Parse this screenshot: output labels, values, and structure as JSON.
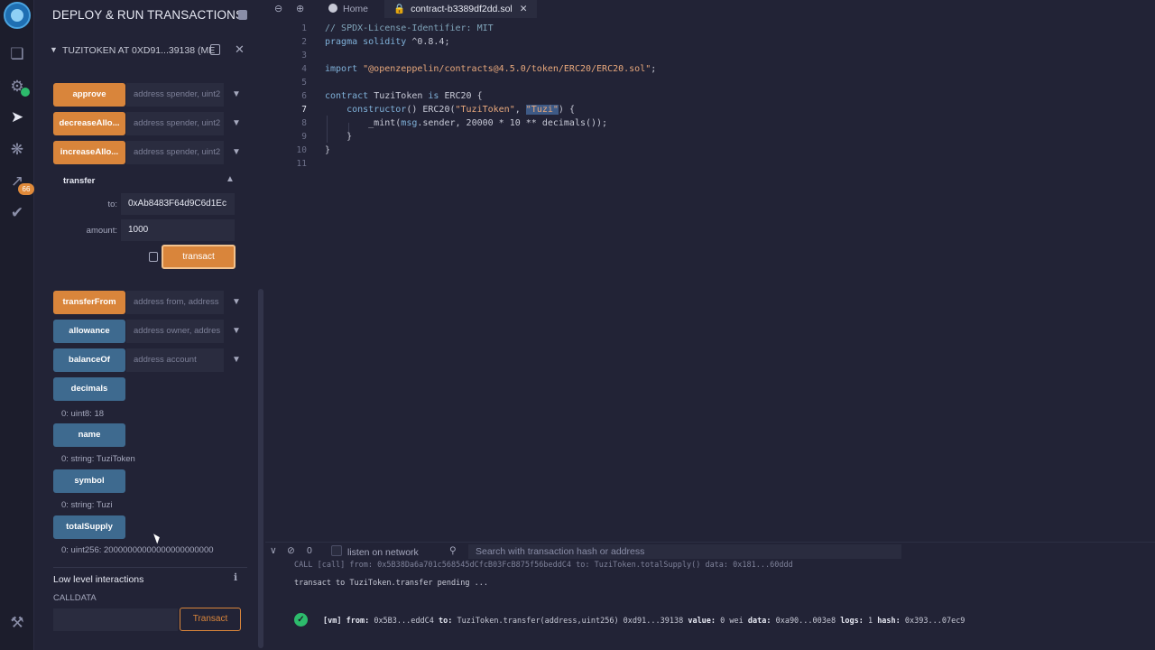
{
  "sidebar": {
    "badge_count": "66",
    "icons": [
      "remix-logo-icon",
      "file-explorer-icon",
      "solidity-compiler-icon",
      "deploy-run-icon",
      "debugger-icon",
      "analysis-icon",
      "unit-test-icon",
      "plugin-manager-icon"
    ]
  },
  "panel": {
    "title": "DEPLOY & RUN TRANSACTIONS",
    "contract_instance": "TUZITOKEN AT 0XD91...39138 (ME",
    "functions_top": [
      {
        "label": "approve",
        "placeholder": "address spender, uint2"
      },
      {
        "label": "decreaseAllo...",
        "placeholder": "address spender, uint2"
      },
      {
        "label": "increaseAllo...",
        "placeholder": "address spender, uint2"
      }
    ],
    "transfer": {
      "label": "transfer",
      "to_label": "to:",
      "to_value": "0xAb8483F64d9C6d1Ec",
      "amount_label": "amount:",
      "amount_value": "1000",
      "transact_label": "transact"
    },
    "functions_bottom": [
      {
        "label": "transferFrom",
        "placeholder": "address from, address"
      },
      {
        "label": "allowance",
        "placeholder": "address owner, addres"
      },
      {
        "label": "balanceOf",
        "placeholder": "address account"
      }
    ],
    "views": [
      {
        "label": "decimals",
        "result": "0: uint8: 18"
      },
      {
        "label": "name",
        "result": "0: string: TuziToken"
      },
      {
        "label": "symbol",
        "result": "0: string: Tuzi"
      },
      {
        "label": "totalSupply",
        "result": "0: uint256: 20000000000000000000000"
      }
    ],
    "low_level_title": "Low level interactions",
    "calldata_label": "CALLDATA",
    "calldata_button": "Transact"
  },
  "editor": {
    "tabs": [
      {
        "label": "Home"
      },
      {
        "label": "contract-b3389df2dd.sol"
      }
    ],
    "line_numbers": [
      "1",
      "2",
      "3",
      "4",
      "5",
      "6",
      "7",
      "8",
      "9",
      "10",
      "11"
    ],
    "code": {
      "l1": "// SPDX-License-Identifier: MIT",
      "l2a": "pragma solidity",
      "l2b": " ^0.8.4;",
      "l4a": "import",
      "l4b": " \"@openzeppelin/contracts@4.5.0/token/ERC20/ERC20.sol\"",
      "l4c": ";",
      "l6a": "contract",
      "l6b": " TuziToken ",
      "l6c": "is",
      "l6d": " ERC20 {",
      "l7a": "    constructor",
      "l7b": "() ERC20(",
      "l7c": "\"TuziToken\"",
      "l7d": ", ",
      "l7e": "\"Tuzi\"",
      "l7f": ") {",
      "l8a": "        _mint(",
      "l8b": "msg",
      "l8c": ".sender, 20000 * 10 ** decimals());",
      "l9": "    }",
      "l10": "}"
    }
  },
  "terminal": {
    "count": "0",
    "listen_label": "listen on network",
    "search_placeholder": "Search with transaction hash or address",
    "line_partial": "CALL   [call] from: 0x5B38Da6a701c568545dCfcB03FcB875f56beddC4 to: TuziToken.totalSupply() data: 0x181...60ddd",
    "line_pending": "transact to TuziToken.transfer pending ...",
    "tx_vm": "[vm]",
    "tx_from_label": "from:",
    "tx_from": " 0x5B3...eddC4 ",
    "tx_to_label": "to:",
    "tx_to": " TuziToken.transfer(address,uint256) 0xd91...39138 ",
    "tx_value_label": "value:",
    "tx_value": " 0 wei ",
    "tx_data_label": "data:",
    "tx_data": " 0xa90...003e8 ",
    "tx_logs_label": "logs:",
    "tx_logs": " 1 ",
    "tx_hash_label": "hash:",
    "tx_hash": " 0x393...07ec9"
  },
  "colors": {
    "accent_orange": "#d9853b",
    "button_blue": "#3e6a8f",
    "success_green": "#2dbb6c",
    "background": "#222336"
  }
}
